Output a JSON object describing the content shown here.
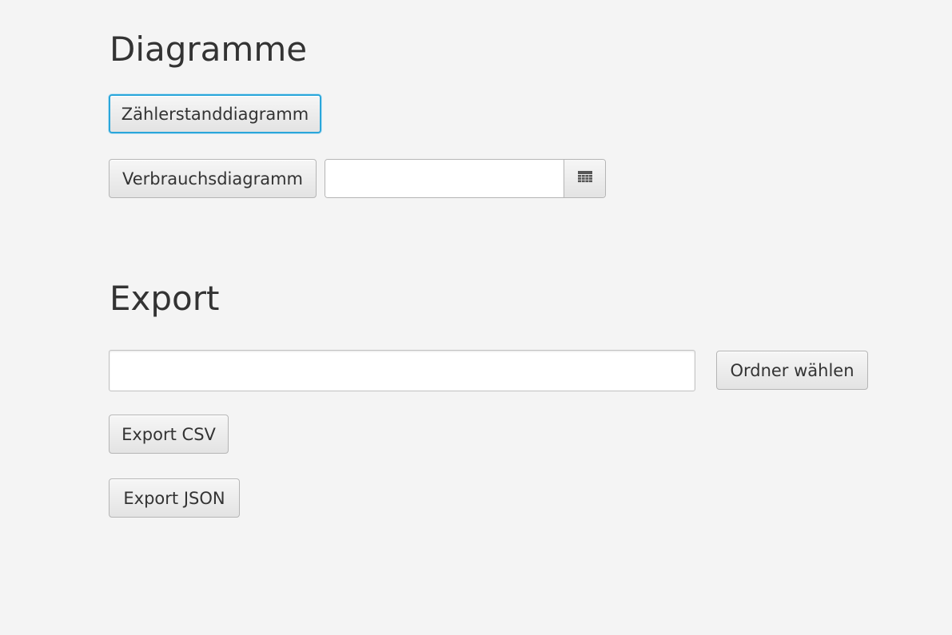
{
  "diagrams": {
    "heading": "Diagramme",
    "meter_chart_button": "Zählerstanddiagramm",
    "consumption_chart_button": "Verbrauchsdiagramm",
    "date_value": "",
    "calendar_icon": "calendar-icon"
  },
  "export": {
    "heading": "Export",
    "folder_path_value": "",
    "choose_folder_button": "Ordner wählen",
    "export_csv_button": "Export CSV",
    "export_json_button": "Export JSON"
  },
  "colors": {
    "background": "#f4f4f4",
    "focus_ring": "#2aa6da",
    "text": "#333333"
  }
}
